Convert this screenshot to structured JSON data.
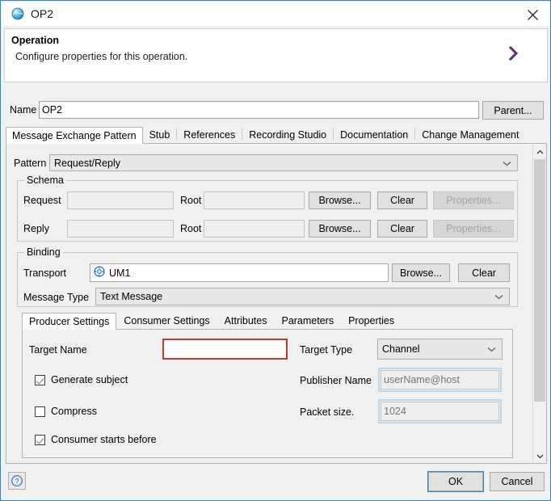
{
  "window": {
    "title": "OP2",
    "title_icon": "sphere-globe-icon",
    "close_icon": "close-icon"
  },
  "description": {
    "heading": "Operation",
    "text": "Configure properties for this operation.",
    "chevron_icon": "chevron-right-icon",
    "chevron_color": "#5c2d7f"
  },
  "name_row": {
    "label": "Name",
    "value": "OP2",
    "parent_button": "Parent..."
  },
  "tabs": [
    {
      "label": "Message Exchange Pattern",
      "selected": true
    },
    {
      "label": "Stub",
      "selected": false
    },
    {
      "label": "References",
      "selected": false
    },
    {
      "label": "Recording Studio",
      "selected": false
    },
    {
      "label": "Documentation",
      "selected": false
    },
    {
      "label": "Change Management",
      "selected": false
    }
  ],
  "pattern": {
    "label": "Pattern",
    "value": "Request/Reply",
    "arrow_icon": "chevron-down-icon"
  },
  "schema": {
    "group_title": "Schema",
    "rows": [
      {
        "label": "Request",
        "value": "",
        "root_label": "Root",
        "root_value": "",
        "browse": "Browse...",
        "clear": "Clear",
        "properties": "Properties..."
      },
      {
        "label": "Reply",
        "value": "",
        "root_label": "Root",
        "root_value": "",
        "browse": "Browse...",
        "clear": "Clear",
        "properties": "Properties..."
      }
    ]
  },
  "binding": {
    "group_title": "Binding",
    "transport_label": "Transport",
    "transport_value": "UM1",
    "transport_icon": "gear-wheel-icon",
    "transport_browse": "Browse...",
    "transport_clear": "Clear",
    "message_type_label": "Message Type",
    "message_type_value": "Text Message",
    "message_type_arrow": "chevron-down-icon"
  },
  "inner_tabs": [
    {
      "label": "Producer Settings",
      "selected": true
    },
    {
      "label": "Consumer Settings",
      "selected": false
    },
    {
      "label": "Attributes",
      "selected": false
    },
    {
      "label": "Parameters",
      "selected": false
    },
    {
      "label": "Properties",
      "selected": false
    }
  ],
  "producer_settings": {
    "target_name_label": "Target Name",
    "target_name_value": "",
    "target_name_error_color": "#c0392b",
    "target_type_label": "Target Type",
    "target_type_value": "Channel",
    "target_type_arrow": "chevron-down-icon",
    "generate_subject_label": "Generate subject",
    "generate_subject_checked": true,
    "publisher_name_label": "Publisher Name",
    "publisher_name_placeholder": "userName@host",
    "compress_label": "Compress",
    "compress_checked": false,
    "packet_size_label": "Packet size.",
    "packet_size_placeholder": "1024",
    "consumer_starts_before_label": "Consumer starts before",
    "consumer_starts_before_checked": true
  },
  "scrollbar": {
    "up_icon": "chevron-up-icon",
    "down_icon": "chevron-down-icon"
  },
  "footer": {
    "help_icon": "question-mark-icon",
    "ok": "OK",
    "cancel": "Cancel"
  }
}
